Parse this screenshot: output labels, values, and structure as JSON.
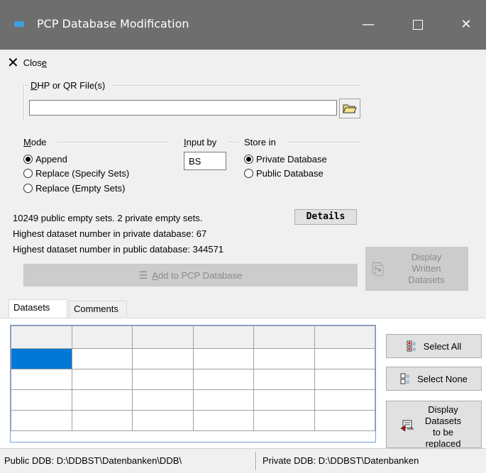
{
  "window": {
    "title": "PCP Database Modification",
    "minimize": "—",
    "close": "✕"
  },
  "toolbar": {
    "close_label": "Clos",
    "close_underline": "e",
    "close_icon": "x-icon"
  },
  "file_group": {
    "label_u": "D",
    "label_rest": "HP or QR File(s)",
    "value": "",
    "browse_icon": "folder-open-icon"
  },
  "mode": {
    "label_u": "M",
    "label_rest": "ode",
    "options": [
      {
        "label": "Append",
        "selected": true
      },
      {
        "label": "Replace (Specify Sets)",
        "selected": false
      },
      {
        "label": "Replace (Empty Sets)",
        "selected": false
      }
    ]
  },
  "input_by": {
    "label_u": "I",
    "label_rest": "nput by",
    "value": "BS"
  },
  "store_in": {
    "label": "Store in",
    "options": [
      {
        "label": "Private Database",
        "selected": true
      },
      {
        "label": "Public Database",
        "selected": false
      }
    ]
  },
  "info": {
    "empty_sets": "10249 public empty sets. 2 private empty sets.",
    "highest_private": "Highest dataset number in private database: 67",
    "highest_public": "Highest dataset number in public database:  344571",
    "details_label": "Details"
  },
  "add_button": {
    "underline": "A",
    "rest": "dd to PCP Database",
    "icon": "database-add-icon"
  },
  "display_written": {
    "line1": "Display",
    "line2": "Written",
    "line3": "Datasets"
  },
  "tabs": [
    {
      "label": "Datasets",
      "active": true
    },
    {
      "label": "Comments",
      "active": false
    }
  ],
  "side_buttons": {
    "select_all": "Select All",
    "select_none": "Select None",
    "display_replaced_1": "Display",
    "display_replaced_2": "Datasets",
    "display_replaced_3": "to be",
    "display_replaced_4": "replaced"
  },
  "status": {
    "public": "Public DDB:  D:\\DDBST\\Datenbanken\\DDB\\",
    "private": "Private DDB:  D:\\DDBST\\Datenbanken"
  },
  "colors": {
    "titlebar": "#6e6e6e",
    "selection": "#0078d7"
  }
}
